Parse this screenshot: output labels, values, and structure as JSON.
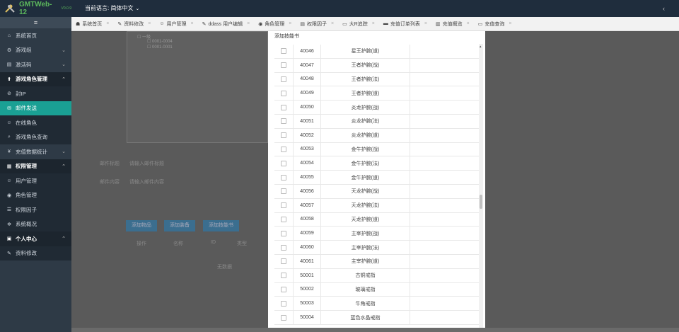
{
  "app": {
    "logo": "GMTWeb-12",
    "version": "V0.0.9",
    "language_label": "当前语言: 简体中文"
  },
  "sidebar": {
    "items": [
      {
        "label": "系统首页",
        "icon": "home-icon",
        "type": "group"
      },
      {
        "label": "游戏组",
        "icon": "gamepad-icon",
        "type": "group",
        "chev": "⌄"
      },
      {
        "label": "激活码",
        "icon": "ticket-icon",
        "type": "group",
        "chev": "⌄"
      },
      {
        "label": "游戏角色管理",
        "icon": "pin-icon",
        "type": "group-open",
        "chev": "⌃"
      },
      {
        "label": "封IP",
        "icon": "ban-icon",
        "type": "sub"
      },
      {
        "label": "邮件发送",
        "icon": "mail-icon",
        "type": "active"
      },
      {
        "label": "在线角色",
        "icon": "user-icon",
        "type": "sub"
      },
      {
        "label": "游戏角色查询",
        "icon": "search-icon",
        "type": "sub"
      },
      {
        "label": "充值数据统计",
        "icon": "yen-icon",
        "type": "group",
        "chev": "⌄"
      },
      {
        "label": "权限管理",
        "icon": "grid-icon",
        "type": "group-open",
        "chev": "⌃"
      },
      {
        "label": "用户管理",
        "icon": "user-icon",
        "type": "sub"
      },
      {
        "label": "角色管理",
        "icon": "user-circle-icon",
        "type": "sub"
      },
      {
        "label": "权限因子",
        "icon": "list-icon",
        "type": "sub"
      },
      {
        "label": "系统概况",
        "icon": "gear-icon",
        "type": "sub"
      },
      {
        "label": "个人中心",
        "icon": "id-card-icon",
        "type": "group-open",
        "chev": "⌃"
      },
      {
        "label": "资料修改",
        "icon": "edit-icon",
        "type": "sub"
      }
    ]
  },
  "tabs": [
    {
      "label": "系统首页",
      "icon": "☗"
    },
    {
      "label": "资料修改",
      "icon": "✎"
    },
    {
      "label": "用户管理",
      "icon": "☺"
    },
    {
      "label": "ddass 用户编辑",
      "icon": "✎"
    },
    {
      "label": "角色管理",
      "icon": "◉"
    },
    {
      "label": "权限因子",
      "icon": "▤"
    },
    {
      "label": "大R追踪",
      "icon": "▭"
    },
    {
      "label": "充值订单列表",
      "icon": "▬"
    },
    {
      "label": "充值概览",
      "icon": "▥"
    },
    {
      "label": "充值查询",
      "icon": "▭"
    }
  ],
  "background_form": {
    "tree_items": [
      "一级",
      "0001-0004",
      "0001-0001"
    ],
    "mail_title_label": "邮件标题",
    "mail_title_placeholder": "请输入邮件标题",
    "mail_content_label": "邮件内容",
    "mail_content_placeholder": "请输入邮件内容",
    "buttons": [
      "添加物品",
      "添加装备",
      "添加技能书"
    ],
    "table_headers": [
      "操作",
      "名称",
      "ID",
      "类型"
    ],
    "empty_text": "无数据"
  },
  "modal": {
    "title": "添加技能书",
    "rows": [
      {
        "id": "40046",
        "name": "星王护腕(道)"
      },
      {
        "id": "40047",
        "name": "王者护腕(战)"
      },
      {
        "id": "40048",
        "name": "王者护腕(法)"
      },
      {
        "id": "40049",
        "name": "王者护腕(道)"
      },
      {
        "id": "40050",
        "name": "炎龙护腕(战)"
      },
      {
        "id": "40051",
        "name": "炎龙护腕(法)"
      },
      {
        "id": "40052",
        "name": "炎龙护腕(道)"
      },
      {
        "id": "40053",
        "name": "金牛护腕(战)"
      },
      {
        "id": "40054",
        "name": "金牛护腕(法)"
      },
      {
        "id": "40055",
        "name": "金牛护腕(道)"
      },
      {
        "id": "40056",
        "name": "天龙护腕(战)"
      },
      {
        "id": "40057",
        "name": "天龙护腕(法)"
      },
      {
        "id": "40058",
        "name": "天龙护腕(道)"
      },
      {
        "id": "40059",
        "name": "主宰护腕(战)"
      },
      {
        "id": "40060",
        "name": "主宰护腕(法)"
      },
      {
        "id": "40061",
        "name": "主宰护腕(道)"
      },
      {
        "id": "50001",
        "name": "古铜戒指"
      },
      {
        "id": "50002",
        "name": "玻璃戒指"
      },
      {
        "id": "50003",
        "name": "牛角戒指"
      },
      {
        "id": "50004",
        "name": "蓝色水晶戒指"
      }
    ]
  },
  "colors": {
    "sidebar": "#2e3a46",
    "active": "#1aa094",
    "header": "#1f2d3d",
    "logo": "#5cb85c"
  }
}
